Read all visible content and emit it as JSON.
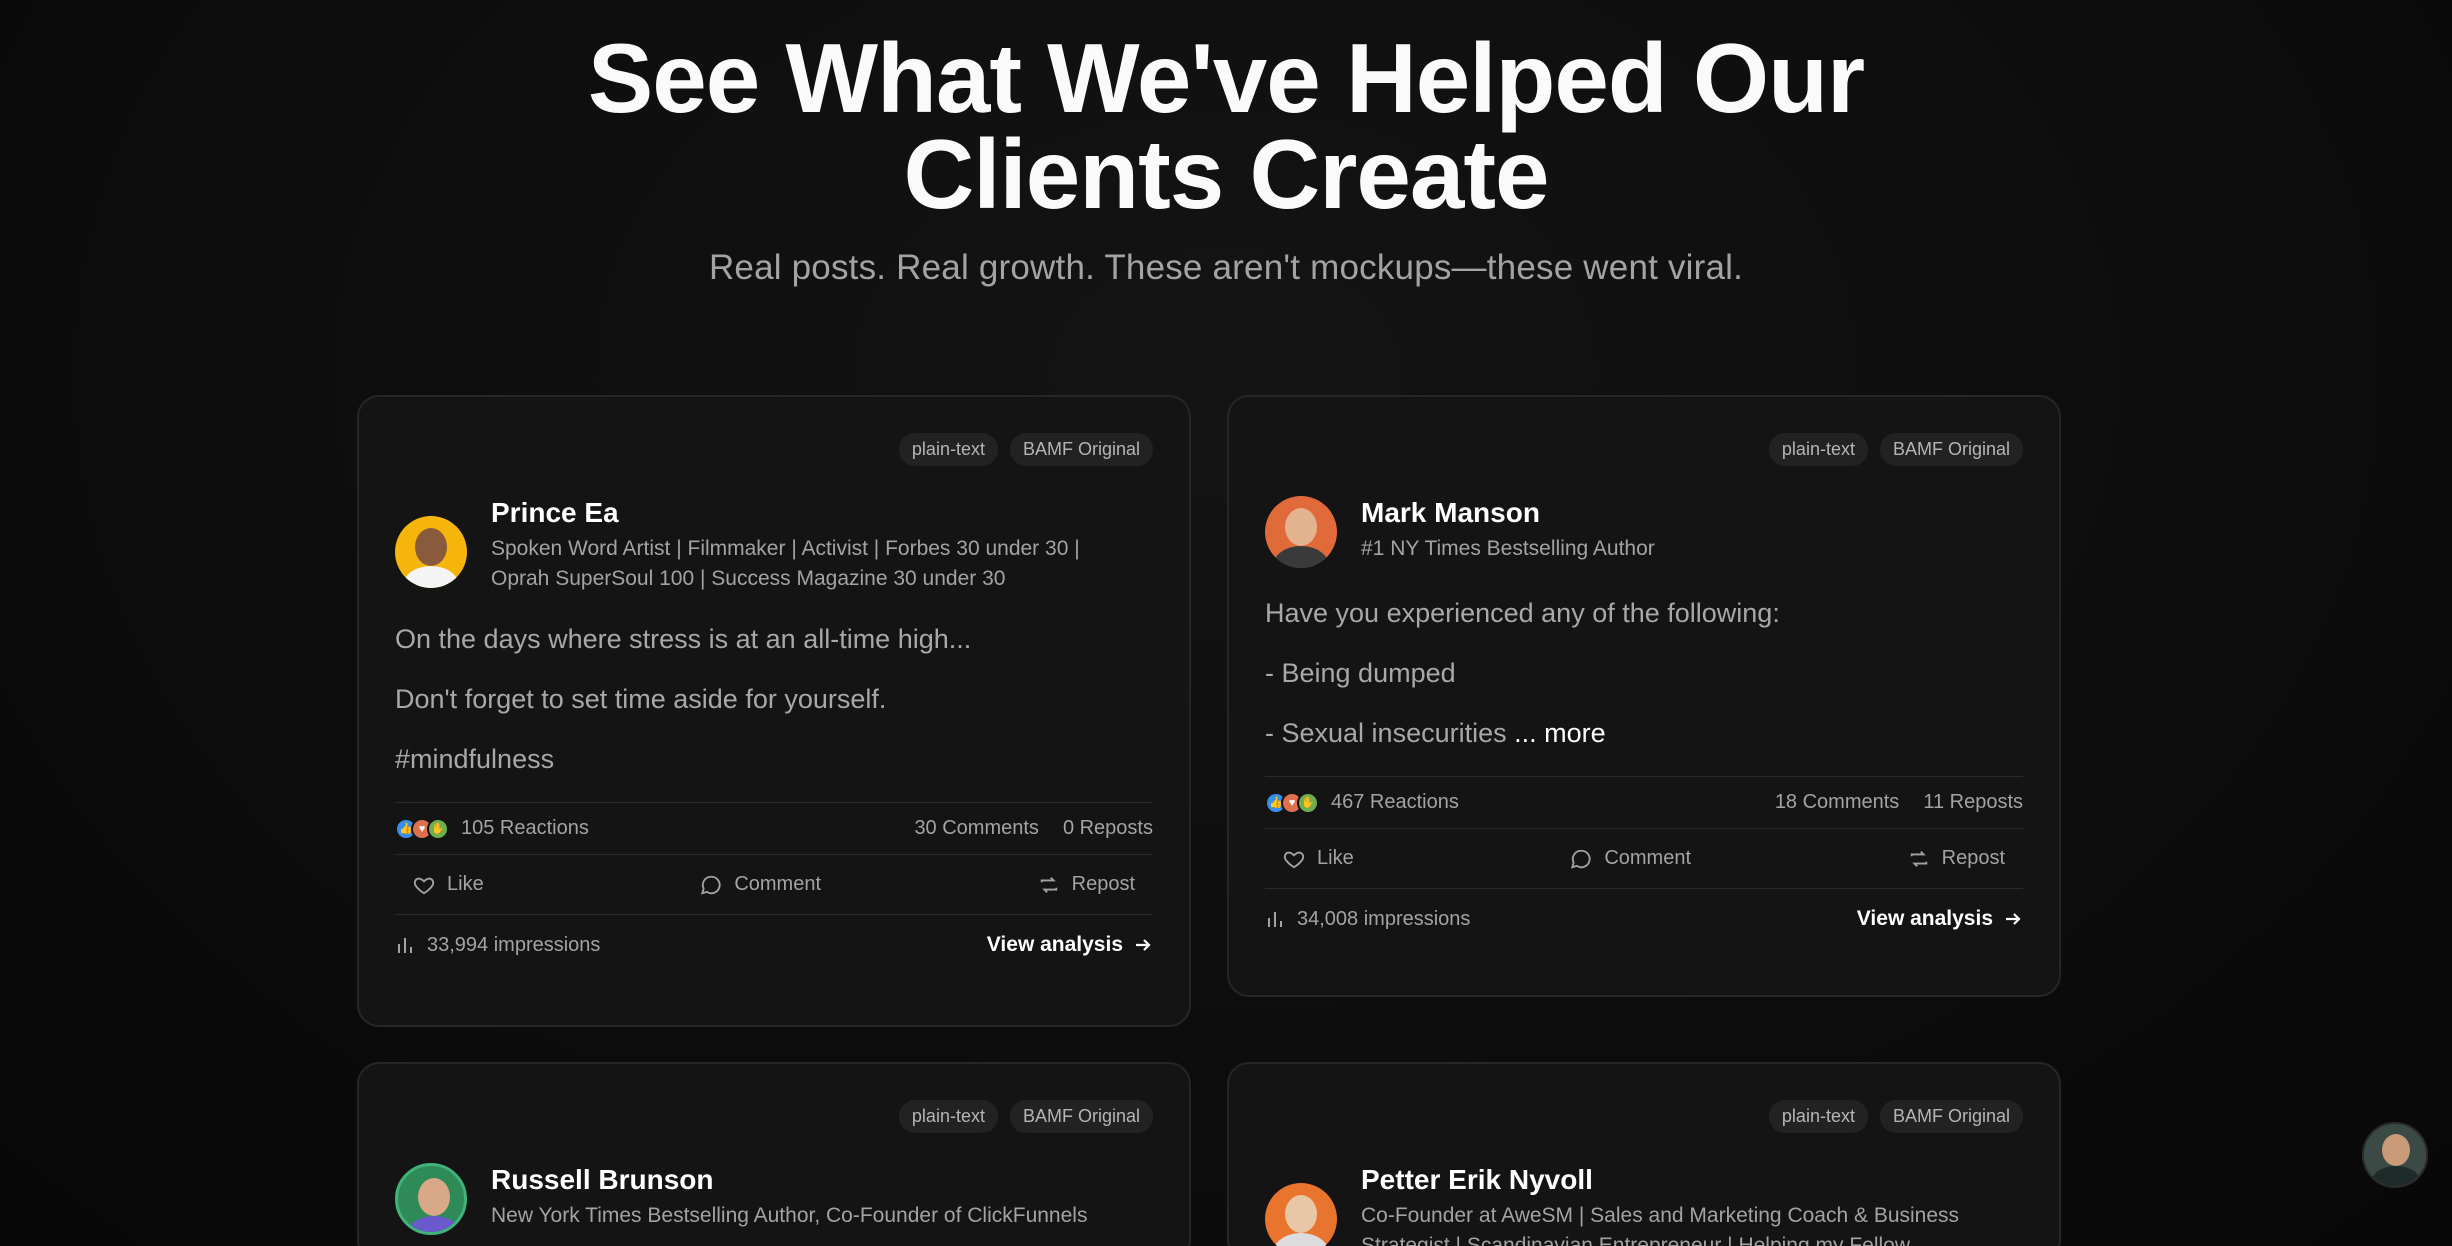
{
  "hero": {
    "title": "See What We've Helped Our Clients Create",
    "subtitle": "Real posts. Real growth. These aren't mockups—these went viral."
  },
  "labels": {
    "like": "Like",
    "comment": "Comment",
    "repost": "Repost",
    "view_analysis": "View analysis"
  },
  "cards": [
    {
      "tags": [
        "plain-text",
        "BAMF Original"
      ],
      "name": "Prince Ea",
      "title": "Spoken Word Artist | Filmmaker | Activist | Forbes 30 under 30 | Oprah SuperSoul 100 | Success Magazine 30 under 30",
      "avatar_bg": "#f5b50a",
      "body": [
        "On the days where stress is at an all-time high...",
        "Don't forget to set time aside for yourself.",
        "#mindfulness"
      ],
      "reactions": "105 Reactions",
      "comments": "30 Comments",
      "reposts": "0 Reposts",
      "impressions": "33,994 impressions"
    },
    {
      "tags": [
        "plain-text",
        "BAMF Original"
      ],
      "name": "Mark Manson",
      "title": "#1 NY Times Bestselling Author",
      "avatar_bg": "#e06a3a",
      "body": [
        "Have you experienced any of the following:",
        "- Being dumped",
        "- Sexual insecurities"
      ],
      "more": "... more",
      "reactions": "467 Reactions",
      "comments": "18 Comments",
      "reposts": "11 Reposts",
      "impressions": "34,008 impressions"
    },
    {
      "tags": [
        "plain-text",
        "BAMF Original"
      ],
      "name": "Russell Brunson",
      "title": "New York Times Bestselling Author, Co-Founder of ClickFunnels",
      "avatar_bg": "#2e8b57"
    },
    {
      "tags": [
        "plain-text",
        "BAMF Original"
      ],
      "name": "Petter Erik Nyvoll",
      "title": "Co-Founder at AweSM | Sales and Marketing Coach & Business Strategist | Scandinavian Entrepreneur | Helping my Fellow",
      "avatar_bg": "#e8742e"
    }
  ]
}
